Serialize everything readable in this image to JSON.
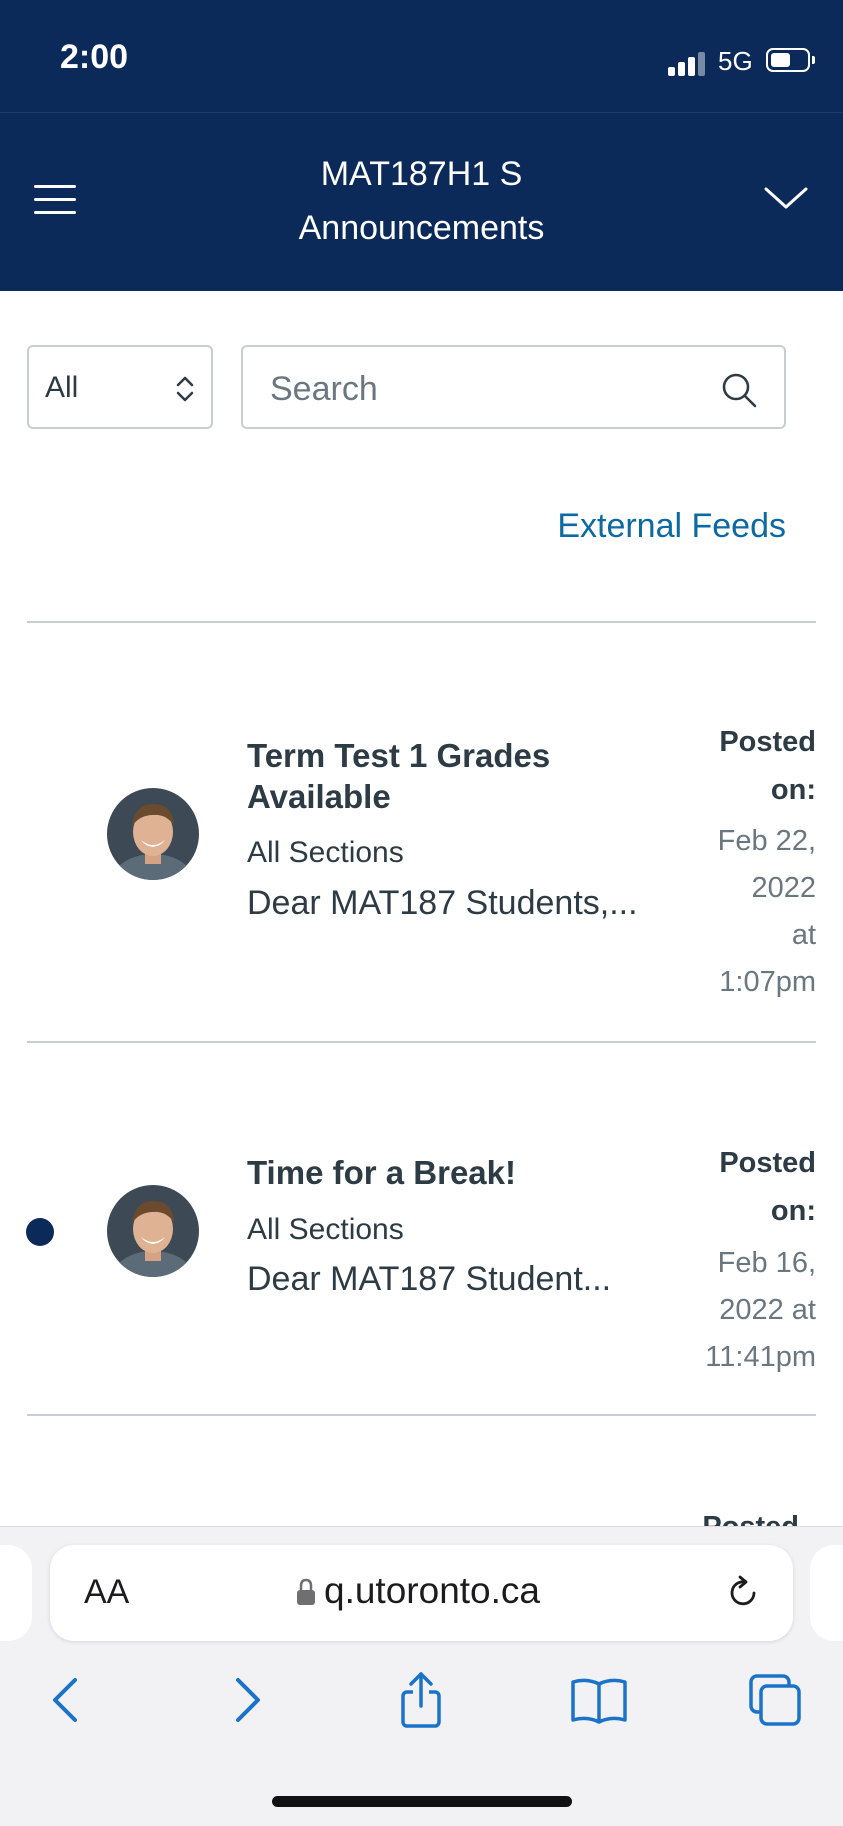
{
  "status_bar": {
    "time": "2:00",
    "network": "5G"
  },
  "header": {
    "course": "MAT187H1 S",
    "page": "Announcements"
  },
  "filter": {
    "selected": "All"
  },
  "search": {
    "placeholder": "Search"
  },
  "external_feeds_label": "External Feeds",
  "announcements": [
    {
      "title": "Term Test 1 Grades Available",
      "sections": "All Sections",
      "snippet": "Dear MAT187 Students,...",
      "posted_label": "Posted on:",
      "posted_lines": [
        "Feb 22,",
        "2022",
        "at",
        "1:07pm"
      ],
      "unread": false
    },
    {
      "title": "Time for a Break!",
      "sections": "All Sections",
      "snippet": "Dear MAT187 Student...",
      "posted_label": "Posted on:",
      "posted_lines": [
        "Feb 16,",
        "2022 at",
        "11:41pm"
      ],
      "unread": true
    }
  ],
  "partial_posted": "Posted",
  "browser": {
    "aa_label": "AA",
    "url": "q.utoronto.ca"
  },
  "colors": {
    "header_bg": "#0b2a5a",
    "link": "#0a6aa1",
    "icon_blue": "#1a73c9"
  }
}
